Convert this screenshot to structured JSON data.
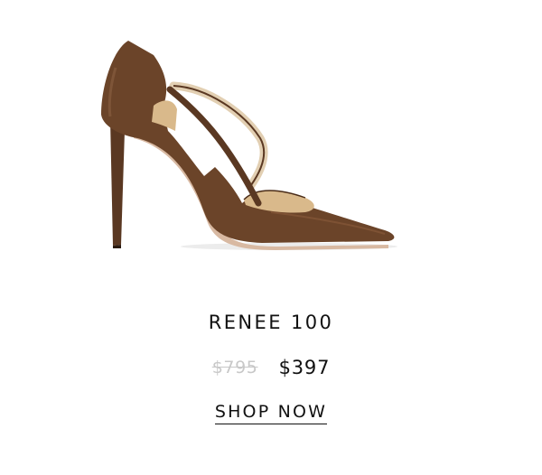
{
  "product": {
    "name": "RENEE 100",
    "original_price": "$795",
    "sale_price": "$397",
    "cta_label": "SHOP NOW",
    "image_icon": "pointed-heel-pump-illustration",
    "colors": {
      "leather": "#6b4429",
      "lining": "#d9b98b",
      "text": "#111111",
      "strikethrough_price": "#c8c8c8"
    }
  }
}
